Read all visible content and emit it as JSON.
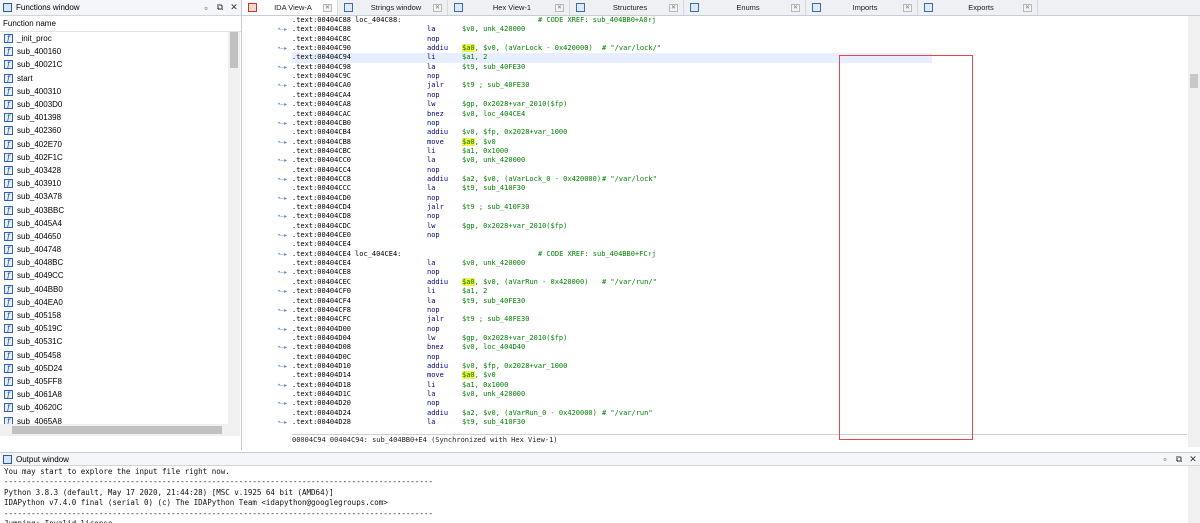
{
  "functions_window": {
    "title": "Functions window",
    "column_header": "Function name",
    "items": [
      "_init_proc",
      "sub_400160",
      "sub_40021C",
      "start",
      "sub_400310",
      "sub_4003D0",
      "sub_401398",
      "sub_402360",
      "sub_402E70",
      "sub_402F1C",
      "sub_403428",
      "sub_403910",
      "sub_403A78",
      "sub_403BBC",
      "sub_4045A4",
      "sub_404650",
      "sub_404748",
      "sub_4048BC",
      "sub_4049CC",
      "sub_404BB0",
      "sub_404EA0",
      "sub_405158",
      "sub_40519C",
      "sub_40531C",
      "sub_405458",
      "sub_405D24",
      "sub_405FF8",
      "sub_4061A8",
      "sub_40620C",
      "sub_4065A8"
    ]
  },
  "tabs": [
    {
      "label": "IDA View-A",
      "icon": "ida-view-icon",
      "active": true
    },
    {
      "label": "Strings window",
      "icon": "strings-icon"
    },
    {
      "label": "Hex View-1",
      "icon": "hex-view-icon"
    },
    {
      "label": "Structures",
      "icon": "structures-icon"
    },
    {
      "label": "Enums",
      "icon": "enums-icon"
    },
    {
      "label": "Imports",
      "icon": "imports-icon"
    },
    {
      "label": "Exports",
      "icon": "exports-icon"
    }
  ],
  "disassembly": {
    "highlight_register": "$a0",
    "lines": [
      {
        "addr": ".text:00404C88",
        "label": "loc_404C88:",
        "comment": "# CODE XREF: sub_404BB0+A0↑j",
        "comment_col": "xref"
      },
      {
        "addr": ".text:00404C88",
        "mn": "la",
        "op": "$v0, unk_420000"
      },
      {
        "addr": ".text:00404C8C",
        "mn": "nop"
      },
      {
        "addr": ".text:00404C90",
        "mn": "addiu",
        "op": "$a0, $v0, (aVarLock - 0x420000)",
        "comment": "# \"/var/lock/\""
      },
      {
        "addr": ".text:00404C94",
        "mn": "li",
        "op": "$a1, 2",
        "highlight": true
      },
      {
        "addr": ".text:00404C98",
        "mn": "la",
        "op": "$t9, sub_40FE30"
      },
      {
        "addr": ".text:00404C9C",
        "mn": "nop"
      },
      {
        "addr": ".text:00404CA0",
        "mn": "jalr",
        "op": "$t9 ; sub_40FE30"
      },
      {
        "addr": ".text:00404CA4",
        "mn": "nop"
      },
      {
        "addr": ".text:00404CA8",
        "mn": "lw",
        "op": "$gp, 0x2028+var_2010($fp)"
      },
      {
        "addr": ".text:00404CAC",
        "mn": "bnez",
        "op": "$v0, loc_404CE4"
      },
      {
        "addr": ".text:00404CB0",
        "mn": "nop"
      },
      {
        "addr": ".text:00404CB4",
        "mn": "addiu",
        "op": "$v0, $fp, 0x2028+var_1000"
      },
      {
        "addr": ".text:00404CB8",
        "mn": "move",
        "op": "$a0, $v0"
      },
      {
        "addr": ".text:00404CBC",
        "mn": "li",
        "op": "$a1, 0x1000"
      },
      {
        "addr": ".text:00404CC0",
        "mn": "la",
        "op": "$v0, unk_420000"
      },
      {
        "addr": ".text:00404CC4",
        "mn": "nop"
      },
      {
        "addr": ".text:00404CC8",
        "mn": "addiu",
        "op": "$a2, $v0, (aVarLock_0 - 0x420000)",
        "comment": "# \"/var/lock\""
      },
      {
        "addr": ".text:00404CCC",
        "mn": "la",
        "op": "$t9, sub_410F30"
      },
      {
        "addr": ".text:00404CD0",
        "mn": "nop"
      },
      {
        "addr": ".text:00404CD4",
        "mn": "jalr",
        "op": "$t9 ; sub_410F30"
      },
      {
        "addr": ".text:00404CD8",
        "mn": "nop"
      },
      {
        "addr": ".text:00404CDC",
        "mn": "lw",
        "op": "$gp, 0x2028+var_2010($fp)"
      },
      {
        "addr": ".text:00404CE0",
        "mn": "nop"
      },
      {
        "addr": ".text:00404CE4"
      },
      {
        "addr": ".text:00404CE4",
        "label": "loc_404CE4:",
        "comment": "# CODE XREF: sub_404BB0+FC↑j",
        "comment_col": "xref"
      },
      {
        "addr": ".text:00404CE4",
        "mn": "la",
        "op": "$v0, unk_420000"
      },
      {
        "addr": ".text:00404CE8",
        "mn": "nop"
      },
      {
        "addr": ".text:00404CEC",
        "mn": "addiu",
        "op": "$a0, $v0, (aVarRun - 0x420000)",
        "comment": "# \"/var/run/\""
      },
      {
        "addr": ".text:00404CF0",
        "mn": "li",
        "op": "$a1, 2"
      },
      {
        "addr": ".text:00404CF4",
        "mn": "la",
        "op": "$t9, sub_40FE30"
      },
      {
        "addr": ".text:00404CF8",
        "mn": "nop"
      },
      {
        "addr": ".text:00404CFC",
        "mn": "jalr",
        "op": "$t9 ; sub_40FE30"
      },
      {
        "addr": ".text:00404D00",
        "mn": "nop"
      },
      {
        "addr": ".text:00404D04",
        "mn": "lw",
        "op": "$gp, 0x2028+var_2010($fp)"
      },
      {
        "addr": ".text:00404D08",
        "mn": "bnez",
        "op": "$v0, loc_404D40"
      },
      {
        "addr": ".text:00404D0C",
        "mn": "nop"
      },
      {
        "addr": ".text:00404D10",
        "mn": "addiu",
        "op": "$v0, $fp, 0x2028+var_1000"
      },
      {
        "addr": ".text:00404D14",
        "mn": "move",
        "op": "$a0, $v0"
      },
      {
        "addr": ".text:00404D18",
        "mn": "li",
        "op": "$a1, 0x1000"
      },
      {
        "addr": ".text:00404D1C",
        "mn": "la",
        "op": "$v0, unk_420000"
      },
      {
        "addr": ".text:00404D20",
        "mn": "nop"
      },
      {
        "addr": ".text:00404D24",
        "mn": "addiu",
        "op": "$a2, $v0, (aVarRun_0 - 0x420000)",
        "comment": "# \"/var/run\""
      },
      {
        "addr": ".text:00404D28",
        "mn": "la",
        "op": "$t9, sub_410F30"
      }
    ],
    "status": "00004C94 00404C94: sub_404BB0+E4 (Synchronized with Hex View-1)"
  },
  "output_window": {
    "title": "Output window",
    "lines": [
      "You may start to explore the input file right now.",
      "-----------------------------------------------------------------------------------------------",
      "Python 3.8.3 (default, May 17 2020, 21:44:28) [MSC v.1925 64 bit (AMD64)]",
      "IDAPython v7.4.0 final (serial 0) (c) The IDAPython Team <idapython@googlegroups.com>",
      "-----------------------------------------------------------------------------------------------",
      "Jumping: Invalid license"
    ]
  },
  "colors": {
    "mnemonic": "#000080",
    "operand": "#008000",
    "register_highlight": "#f5f04a",
    "annotation_box": "#e04a4a"
  }
}
